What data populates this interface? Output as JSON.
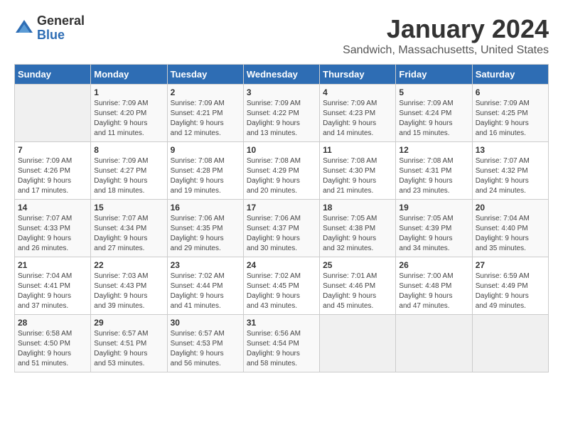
{
  "logo": {
    "general": "General",
    "blue": "Blue"
  },
  "title": "January 2024",
  "subtitle": "Sandwich, Massachusetts, United States",
  "weekdays": [
    "Sunday",
    "Monday",
    "Tuesday",
    "Wednesday",
    "Thursday",
    "Friday",
    "Saturday"
  ],
  "weeks": [
    [
      {
        "day": "",
        "info": ""
      },
      {
        "day": "1",
        "info": "Sunrise: 7:09 AM\nSunset: 4:20 PM\nDaylight: 9 hours\nand 11 minutes."
      },
      {
        "day": "2",
        "info": "Sunrise: 7:09 AM\nSunset: 4:21 PM\nDaylight: 9 hours\nand 12 minutes."
      },
      {
        "day": "3",
        "info": "Sunrise: 7:09 AM\nSunset: 4:22 PM\nDaylight: 9 hours\nand 13 minutes."
      },
      {
        "day": "4",
        "info": "Sunrise: 7:09 AM\nSunset: 4:23 PM\nDaylight: 9 hours\nand 14 minutes."
      },
      {
        "day": "5",
        "info": "Sunrise: 7:09 AM\nSunset: 4:24 PM\nDaylight: 9 hours\nand 15 minutes."
      },
      {
        "day": "6",
        "info": "Sunrise: 7:09 AM\nSunset: 4:25 PM\nDaylight: 9 hours\nand 16 minutes."
      }
    ],
    [
      {
        "day": "7",
        "info": "Sunrise: 7:09 AM\nSunset: 4:26 PM\nDaylight: 9 hours\nand 17 minutes."
      },
      {
        "day": "8",
        "info": "Sunrise: 7:09 AM\nSunset: 4:27 PM\nDaylight: 9 hours\nand 18 minutes."
      },
      {
        "day": "9",
        "info": "Sunrise: 7:08 AM\nSunset: 4:28 PM\nDaylight: 9 hours\nand 19 minutes."
      },
      {
        "day": "10",
        "info": "Sunrise: 7:08 AM\nSunset: 4:29 PM\nDaylight: 9 hours\nand 20 minutes."
      },
      {
        "day": "11",
        "info": "Sunrise: 7:08 AM\nSunset: 4:30 PM\nDaylight: 9 hours\nand 21 minutes."
      },
      {
        "day": "12",
        "info": "Sunrise: 7:08 AM\nSunset: 4:31 PM\nDaylight: 9 hours\nand 23 minutes."
      },
      {
        "day": "13",
        "info": "Sunrise: 7:07 AM\nSunset: 4:32 PM\nDaylight: 9 hours\nand 24 minutes."
      }
    ],
    [
      {
        "day": "14",
        "info": "Sunrise: 7:07 AM\nSunset: 4:33 PM\nDaylight: 9 hours\nand 26 minutes."
      },
      {
        "day": "15",
        "info": "Sunrise: 7:07 AM\nSunset: 4:34 PM\nDaylight: 9 hours\nand 27 minutes."
      },
      {
        "day": "16",
        "info": "Sunrise: 7:06 AM\nSunset: 4:35 PM\nDaylight: 9 hours\nand 29 minutes."
      },
      {
        "day": "17",
        "info": "Sunrise: 7:06 AM\nSunset: 4:37 PM\nDaylight: 9 hours\nand 30 minutes."
      },
      {
        "day": "18",
        "info": "Sunrise: 7:05 AM\nSunset: 4:38 PM\nDaylight: 9 hours\nand 32 minutes."
      },
      {
        "day": "19",
        "info": "Sunrise: 7:05 AM\nSunset: 4:39 PM\nDaylight: 9 hours\nand 34 minutes."
      },
      {
        "day": "20",
        "info": "Sunrise: 7:04 AM\nSunset: 4:40 PM\nDaylight: 9 hours\nand 35 minutes."
      }
    ],
    [
      {
        "day": "21",
        "info": "Sunrise: 7:04 AM\nSunset: 4:41 PM\nDaylight: 9 hours\nand 37 minutes."
      },
      {
        "day": "22",
        "info": "Sunrise: 7:03 AM\nSunset: 4:43 PM\nDaylight: 9 hours\nand 39 minutes."
      },
      {
        "day": "23",
        "info": "Sunrise: 7:02 AM\nSunset: 4:44 PM\nDaylight: 9 hours\nand 41 minutes."
      },
      {
        "day": "24",
        "info": "Sunrise: 7:02 AM\nSunset: 4:45 PM\nDaylight: 9 hours\nand 43 minutes."
      },
      {
        "day": "25",
        "info": "Sunrise: 7:01 AM\nSunset: 4:46 PM\nDaylight: 9 hours\nand 45 minutes."
      },
      {
        "day": "26",
        "info": "Sunrise: 7:00 AM\nSunset: 4:48 PM\nDaylight: 9 hours\nand 47 minutes."
      },
      {
        "day": "27",
        "info": "Sunrise: 6:59 AM\nSunset: 4:49 PM\nDaylight: 9 hours\nand 49 minutes."
      }
    ],
    [
      {
        "day": "28",
        "info": "Sunrise: 6:58 AM\nSunset: 4:50 PM\nDaylight: 9 hours\nand 51 minutes."
      },
      {
        "day": "29",
        "info": "Sunrise: 6:57 AM\nSunset: 4:51 PM\nDaylight: 9 hours\nand 53 minutes."
      },
      {
        "day": "30",
        "info": "Sunrise: 6:57 AM\nSunset: 4:53 PM\nDaylight: 9 hours\nand 56 minutes."
      },
      {
        "day": "31",
        "info": "Sunrise: 6:56 AM\nSunset: 4:54 PM\nDaylight: 9 hours\nand 58 minutes."
      },
      {
        "day": "",
        "info": ""
      },
      {
        "day": "",
        "info": ""
      },
      {
        "day": "",
        "info": ""
      }
    ]
  ]
}
